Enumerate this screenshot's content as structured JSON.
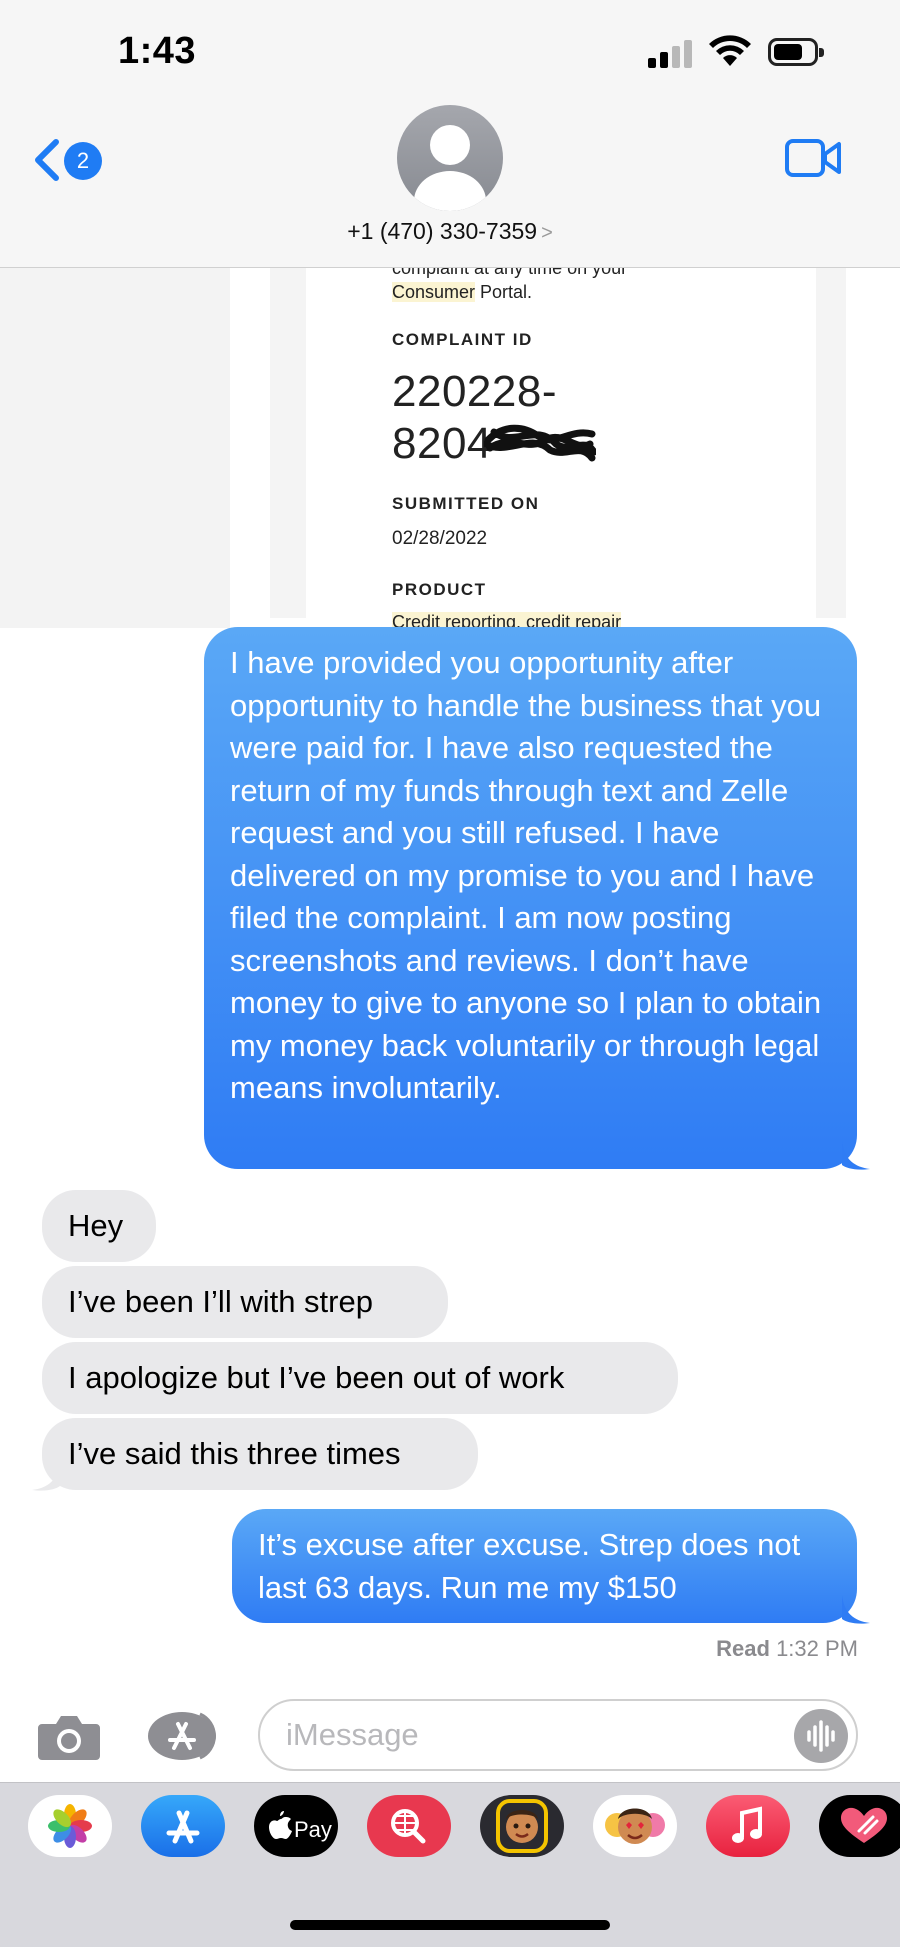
{
  "status_bar": {
    "time": "1:43"
  },
  "header": {
    "back_badge": "2",
    "contact": "+1 (470) 330-7359",
    "caret": ">"
  },
  "screenshot": {
    "cut_text": "complaint at any time on your",
    "consumer": "Consumer",
    "portal": " Portal.",
    "complaint_id_label": "COMPLAINT ID",
    "complaint_id_line1": "220228-",
    "complaint_id_line2": "8204",
    "submitted_label": "SUBMITTED ON",
    "submitted_date": "02/28/2022",
    "product_label": "PRODUCT",
    "product_value": "Credit reporting, credit repair"
  },
  "messages": {
    "sent_long": "I have provided you opportunity after opportunity to handle the business that you were paid for. I have also requested the return of my funds through text and Zelle request and you still refused. I have delivered on my promise to you and I have filed the complaint. I am now posting screenshots and reviews. I don’t have money to give to anyone so I plan to obtain my money back voluntarily or through legal means involuntarily.",
    "recv_1": "Hey",
    "recv_2": "I’ve been I’ll with strep",
    "recv_3": "I apologize but I’ve been out of work",
    "recv_4": "I’ve said this three times",
    "sent_last": "It’s excuse after excuse. Strep does not last 63 days. Run me my $150",
    "read_label": "Read",
    "read_time": "1:32 PM"
  },
  "composer": {
    "placeholder": "iMessage"
  },
  "app_drawer": {
    "items": [
      {
        "icon": "photos-icon"
      },
      {
        "icon": "app-store-icon"
      },
      {
        "icon": "apple-pay-icon",
        "label": "Pay"
      },
      {
        "icon": "web-search-icon"
      },
      {
        "icon": "memoji-icon"
      },
      {
        "icon": "memoji-stickers-icon"
      },
      {
        "icon": "music-icon"
      },
      {
        "icon": "digital-touch-icon"
      }
    ]
  },
  "colors": {
    "sent_bubble": "#2f7cf4",
    "recv_bubble": "#e9e9eb",
    "accent": "#1f7cf4"
  }
}
